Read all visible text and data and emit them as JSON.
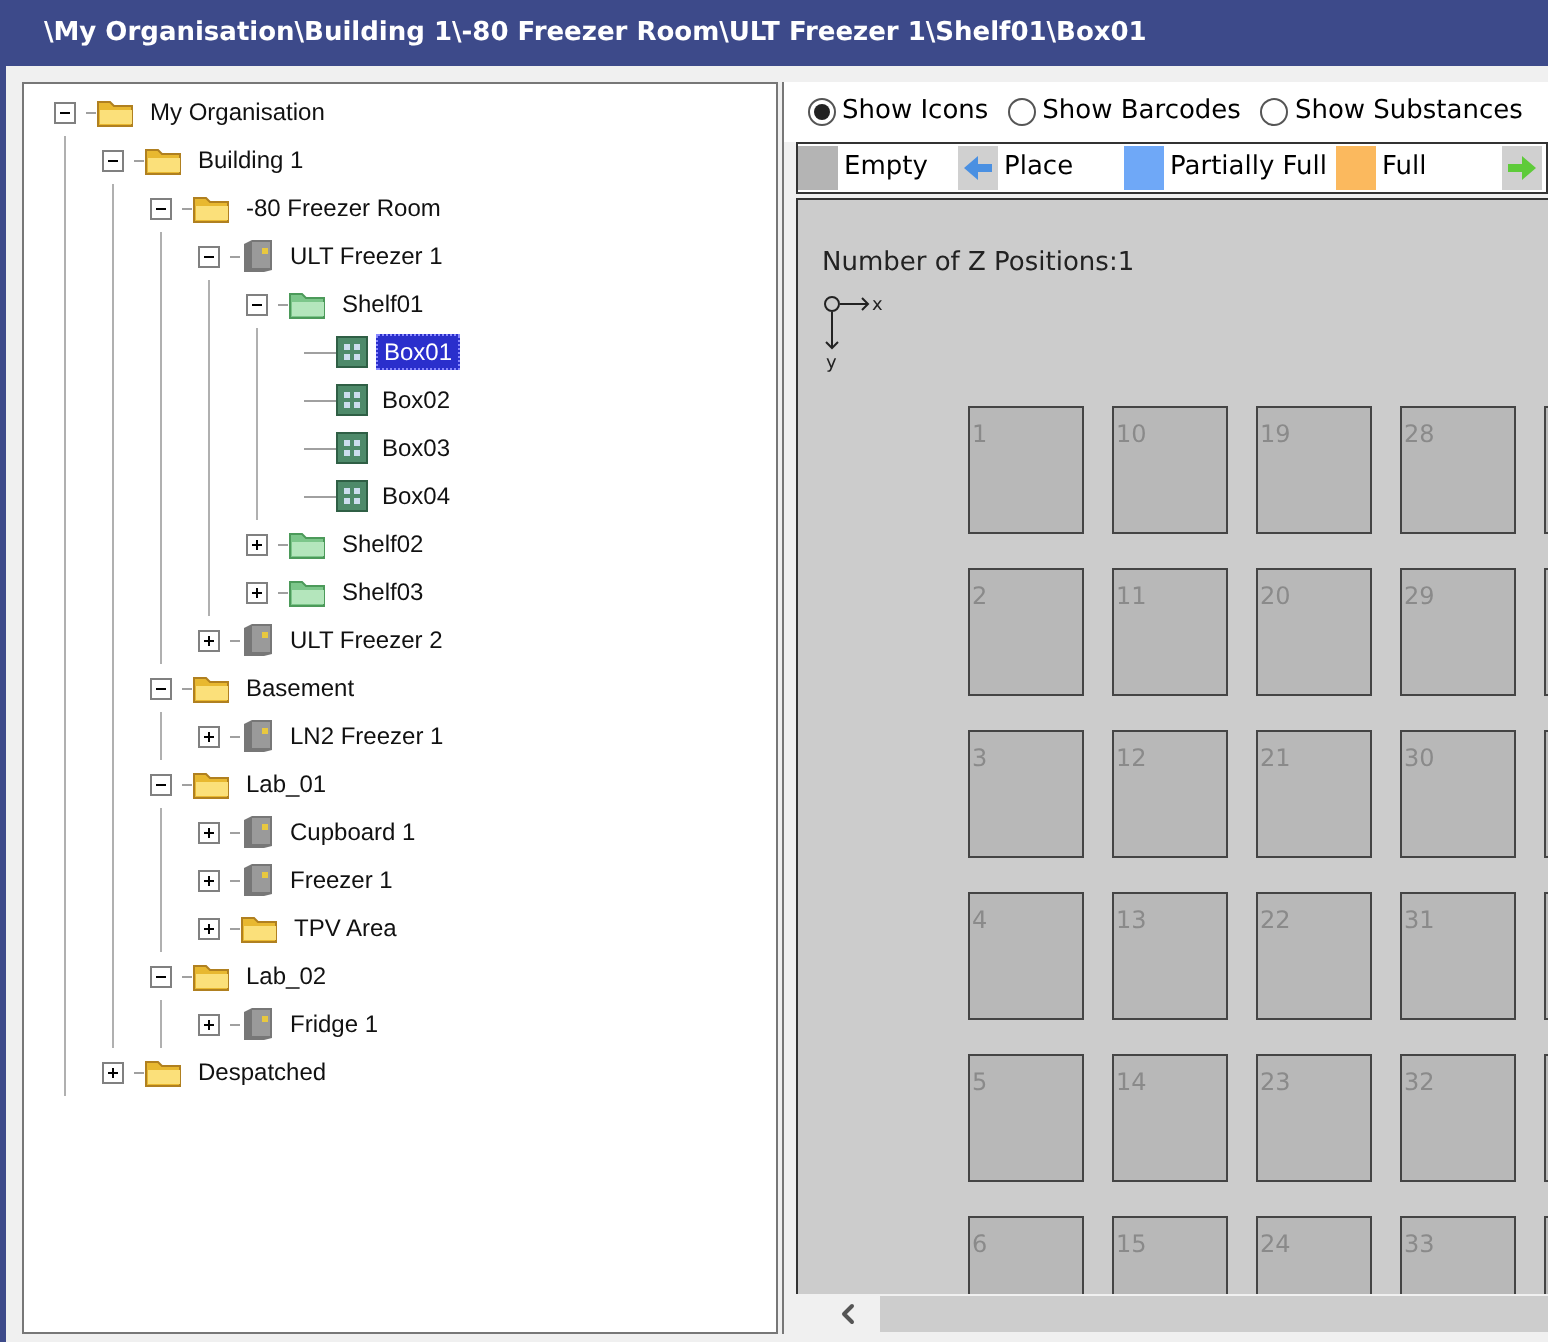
{
  "window": {
    "title": "\\My Organisation\\Building 1\\-80 Freezer Room\\ULT Freezer 1\\Shelf01\\Box01"
  },
  "tree": [
    {
      "label": "My Organisation",
      "kind": "folder",
      "expanded": true,
      "selected": false,
      "children": [
        {
          "label": "Building 1",
          "kind": "folder",
          "expanded": true,
          "selected": false,
          "children": [
            {
              "label": "-80 Freezer Room",
              "kind": "folder",
              "expanded": true,
              "selected": false,
              "children": [
                {
                  "label": "ULT Freezer 1",
                  "kind": "freezer",
                  "expanded": true,
                  "selected": false,
                  "children": [
                    {
                      "label": "Shelf01",
                      "kind": "shelf",
                      "expanded": true,
                      "selected": false,
                      "children": [
                        {
                          "label": "Box01",
                          "kind": "box",
                          "selected": true
                        },
                        {
                          "label": "Box02",
                          "kind": "box",
                          "selected": false
                        },
                        {
                          "label": "Box03",
                          "kind": "box",
                          "selected": false
                        },
                        {
                          "label": "Box04",
                          "kind": "box",
                          "selected": false
                        }
                      ]
                    },
                    {
                      "label": "Shelf02",
                      "kind": "shelf",
                      "expanded": false,
                      "selected": false
                    },
                    {
                      "label": "Shelf03",
                      "kind": "shelf",
                      "expanded": false,
                      "selected": false
                    }
                  ]
                },
                {
                  "label": "ULT Freezer 2",
                  "kind": "freezer",
                  "expanded": false,
                  "selected": false
                }
              ]
            },
            {
              "label": "Basement",
              "kind": "folder",
              "expanded": true,
              "selected": false,
              "children": [
                {
                  "label": "LN2 Freezer 1",
                  "kind": "freezer",
                  "expanded": false,
                  "selected": false
                }
              ]
            },
            {
              "label": "Lab_01",
              "kind": "folder",
              "expanded": true,
              "selected": false,
              "children": [
                {
                  "label": "Cupboard 1",
                  "kind": "freezer",
                  "expanded": false,
                  "selected": false
                },
                {
                  "label": "Freezer 1",
                  "kind": "freezer",
                  "expanded": false,
                  "selected": false
                },
                {
                  "label": "TPV Area",
                  "kind": "folder",
                  "expanded": false,
                  "selected": false
                }
              ]
            },
            {
              "label": "Lab_02",
              "kind": "folder",
              "expanded": true,
              "selected": false,
              "children": [
                {
                  "label": "Fridge 1",
                  "kind": "freezer",
                  "expanded": false,
                  "selected": false
                }
              ]
            }
          ]
        },
        {
          "label": "Despatched",
          "kind": "folder",
          "expanded": false,
          "selected": false
        }
      ]
    }
  ],
  "view_options": [
    {
      "label": "Show Icons",
      "selected": true
    },
    {
      "label": "Show Barcodes",
      "selected": false
    },
    {
      "label": "Show Substances",
      "selected": false
    }
  ],
  "legend": [
    {
      "kind": "swatch",
      "label": "Empty",
      "color": "#b4b4b4"
    },
    {
      "kind": "arrow-left",
      "label": "Place",
      "color": "#4a90e2"
    },
    {
      "kind": "swatch",
      "label": "Partially Full",
      "color": "#6fa8f7"
    },
    {
      "kind": "swatch",
      "label": "Full",
      "color": "#fbb95e"
    },
    {
      "kind": "arrow-right",
      "color": "#5ecb3a"
    }
  ],
  "z_positions": "Number of Z Positions:1",
  "axes": {
    "x": "x",
    "y": "y"
  },
  "grid": [
    [
      "1",
      "10",
      "19",
      "28"
    ],
    [
      "2",
      "11",
      "20",
      "29"
    ],
    [
      "3",
      "12",
      "21",
      "30"
    ],
    [
      "4",
      "13",
      "22",
      "31"
    ],
    [
      "5",
      "14",
      "23",
      "32"
    ],
    [
      "6",
      "15",
      "24",
      "33"
    ]
  ]
}
